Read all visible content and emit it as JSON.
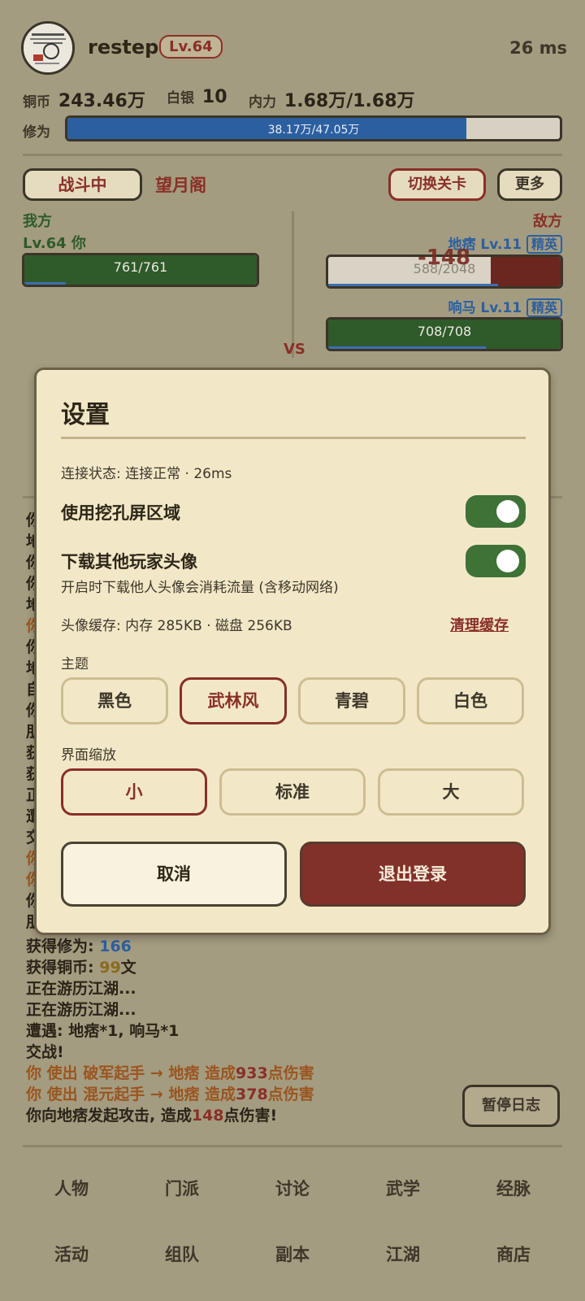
{
  "header": {
    "username": "restep",
    "level": "Lv.64",
    "ping": "26 ms",
    "copper_label": "铜币",
    "copper_value": "243.46万",
    "silver_label": "白银",
    "silver_value": "10",
    "neili_label": "内力",
    "neili_value": "1.68万/1.68万",
    "xiuwei_label": "修为",
    "xiuwei_text": "38.17万/47.05万",
    "xiuwei_progress": 0.81
  },
  "battle": {
    "status_button": "战斗中",
    "location": "望月阁",
    "switch_button": "切换关卡",
    "more_button": "更多",
    "ally_label": "我方",
    "enemy_label": "敌方",
    "vs": "VS",
    "ally": {
      "name": "Lv.64 你",
      "hp_text": "761/761",
      "hp_fraction": 1.0,
      "mp_fraction": 0.18
    },
    "enemies": [
      {
        "name": "地痞 Lv.11",
        "tag": "精英",
        "hp_text": "588/2048",
        "hp_fraction": 0.287,
        "mp_fraction": 0.73,
        "damage_popup": "-148"
      },
      {
        "name": "响马 Lv.11",
        "tag": "精英",
        "hp_text": "708/708",
        "hp_fraction": 1.0,
        "mp_fraction": 0.68
      }
    ]
  },
  "log": {
    "partial_left_chars": [
      "你",
      "地",
      "你",
      "你",
      "地",
      "你",
      "你",
      "地",
      "自",
      "你",
      "朋",
      "获",
      "获",
      "正",
      "遭",
      "交",
      "你",
      "你",
      "你",
      "朋"
    ],
    "lines": [
      {
        "prefix": "获得修为: ",
        "num": "166",
        "suffix": ""
      },
      {
        "prefix": "获得铜币: ",
        "num": "99",
        "suffix": "文"
      },
      {
        "text": "正在游历江湖..."
      },
      {
        "text": "正在游历江湖..."
      },
      {
        "text": "遭遇: 地痞*1, 响马*1"
      },
      {
        "text": "交战!"
      },
      {
        "skill_prefix": "你 使出 破军起手 → 地痞 造成",
        "num": "933",
        "suffix": "点伤害"
      },
      {
        "skill_prefix": "你 使出 混元起手 → 地痞 造成",
        "num": "378",
        "suffix": "点伤害"
      },
      {
        "attack_prefix": "你向地痞发起攻击, 造成",
        "num": "148",
        "suffix": "点伤害!"
      }
    ],
    "pause_button": "暂停日志"
  },
  "nav": {
    "row1": [
      "人物",
      "门派",
      "讨论",
      "武学",
      "经脉"
    ],
    "row2": [
      "活动",
      "组队",
      "副本",
      "江湖",
      "商店"
    ]
  },
  "settings": {
    "title": "设置",
    "connection": "连接状态: 连接正常 · 26ms",
    "notch_label": "使用挖孔屏区域",
    "notch_on": true,
    "avatar_dl_label": "下载其他玩家头像",
    "avatar_dl_note": "开启时下载他人头像会消耗流量 (含移动网络)",
    "avatar_dl_on": true,
    "cache_info": "头像缓存: 内存 285KB · 磁盘 256KB",
    "clear_cache": "清理缓存",
    "theme_label": "主题",
    "themes": [
      "黑色",
      "武林风",
      "青碧",
      "白色"
    ],
    "theme_selected": "武林风",
    "scale_label": "界面缩放",
    "scales": [
      "小",
      "标准",
      "大"
    ],
    "scale_selected": "小",
    "cancel": "取消",
    "logout": "退出登录"
  },
  "colors": {
    "page_bg": "#a49c80",
    "dialog_bg": "#f2e8c8",
    "accent_red": "#8a2f27",
    "toggle_green": "#3e7236",
    "hp_green": "#2f5a2a",
    "xp_blue": "#2c5fa0"
  }
}
